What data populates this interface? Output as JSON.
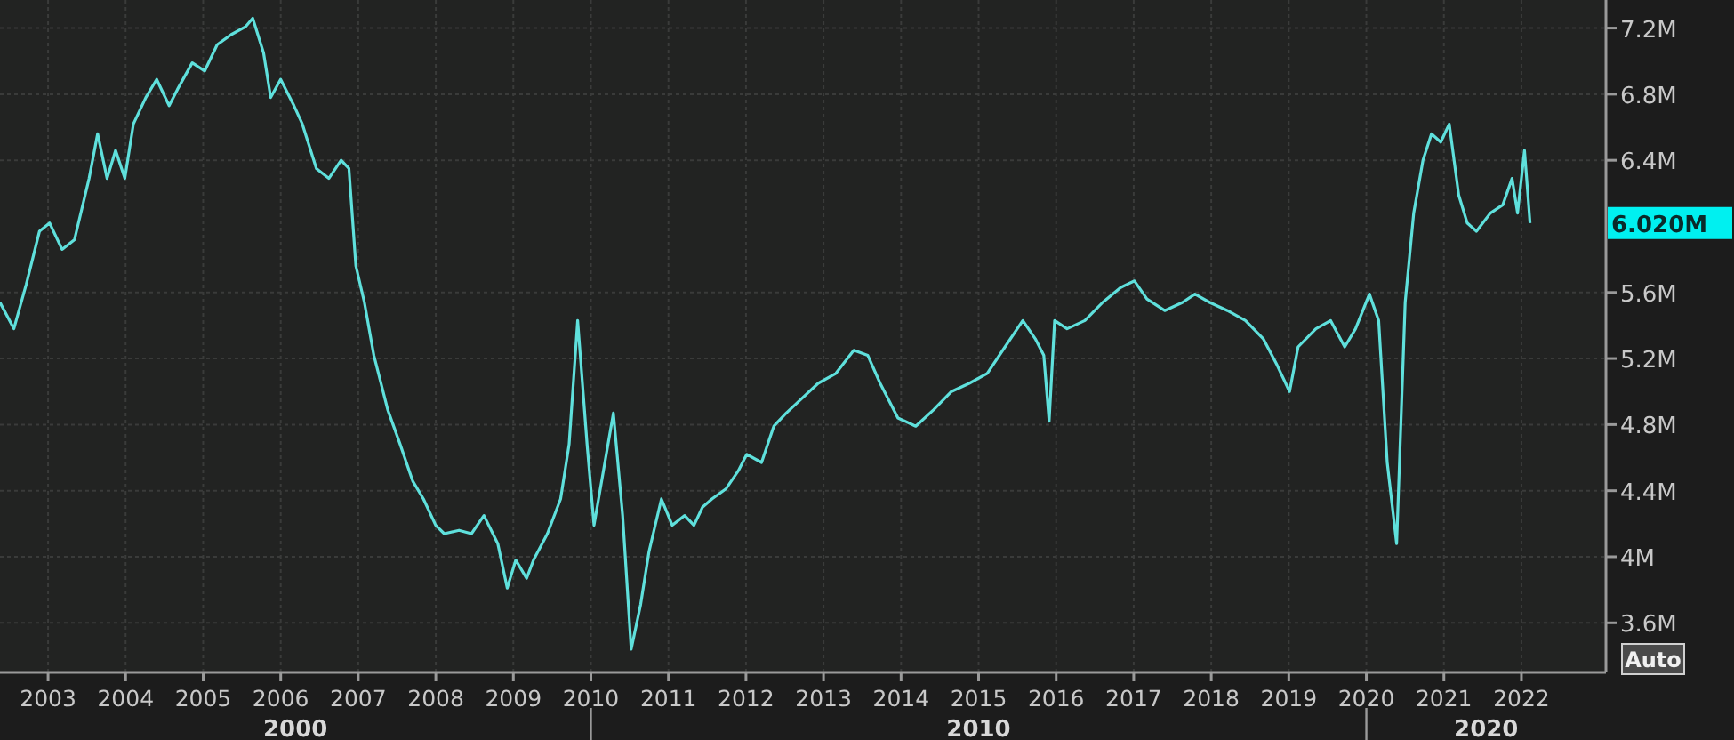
{
  "chart": {
    "chart_data": {
      "type": "line",
      "x": [
        2002.38,
        2002.56,
        2002.72,
        2002.89,
        2003.02,
        2003.18,
        2003.34,
        2003.53,
        2003.64,
        2003.76,
        2003.87,
        2003.99,
        2004.1,
        2004.26,
        2004.4,
        2004.56,
        2004.67,
        2004.86,
        2005.02,
        2005.18,
        2005.36,
        2005.55,
        2005.64,
        2005.78,
        2005.87,
        2006.0,
        2006.17,
        2006.28,
        2006.46,
        2006.62,
        2006.78,
        2006.88,
        2006.97,
        2007.08,
        2007.2,
        2007.38,
        2007.54,
        2007.7,
        2007.84,
        2008.0,
        2008.11,
        2008.3,
        2008.46,
        2008.62,
        2008.8,
        2008.92,
        2009.03,
        2009.17,
        2009.26,
        2009.44,
        2009.61,
        2009.72,
        2009.83,
        2009.95,
        2010.04,
        2010.18,
        2010.29,
        2010.41,
        2010.52,
        2010.64,
        2010.75,
        2010.91,
        2011.05,
        2011.21,
        2011.33,
        2011.44,
        2011.56,
        2011.74,
        2011.9,
        2012.01,
        2012.2,
        2012.36,
        2012.52,
        2012.7,
        2012.93,
        2013.16,
        2013.39,
        2013.57,
        2013.73,
        2013.96,
        2014.19,
        2014.42,
        2014.65,
        2014.88,
        2015.11,
        2015.34,
        2015.57,
        2015.73,
        2015.84,
        2015.91,
        2015.98,
        2016.14,
        2016.37,
        2016.6,
        2016.83,
        2017.01,
        2017.17,
        2017.4,
        2017.63,
        2017.79,
        2017.98,
        2018.21,
        2018.44,
        2018.67,
        2018.85,
        2019.01,
        2019.12,
        2019.35,
        2019.54,
        2019.72,
        2019.86,
        2020.04,
        2020.16,
        2020.27,
        2020.39,
        2020.5,
        2020.61,
        2020.73,
        2020.84,
        2020.96,
        2021.07,
        2021.19,
        2021.3,
        2021.42,
        2021.6,
        2021.76,
        2021.88,
        2021.95,
        2022.04,
        2022.11
      ],
      "series": [
        {
          "color": "#5fe0dc",
          "values": [
            5.54,
            5.38,
            5.65,
            5.97,
            6.02,
            5.86,
            5.92,
            6.29,
            6.56,
            6.29,
            6.46,
            6.29,
            6.62,
            6.78,
            6.89,
            6.73,
            6.83,
            6.99,
            6.94,
            7.1,
            7.16,
            7.21,
            7.26,
            7.05,
            6.78,
            6.89,
            6.73,
            6.62,
            6.35,
            6.29,
            6.4,
            6.35,
            5.76,
            5.54,
            5.22,
            4.89,
            4.68,
            4.46,
            4.35,
            4.19,
            4.14,
            4.16,
            4.14,
            4.25,
            4.08,
            3.81,
            3.98,
            3.87,
            3.98,
            4.14,
            4.35,
            4.68,
            5.43,
            4.68,
            4.19,
            4.57,
            4.87,
            4.25,
            3.44,
            3.71,
            4.03,
            4.35,
            4.19,
            4.25,
            4.19,
            4.3,
            4.35,
            4.41,
            4.52,
            4.62,
            4.57,
            4.79,
            4.87,
            4.95,
            5.05,
            5.11,
            5.25,
            5.22,
            5.05,
            4.84,
            4.79,
            4.89,
            5.0,
            5.05,
            5.11,
            5.27,
            5.43,
            5.32,
            5.22,
            4.82,
            5.43,
            5.38,
            5.43,
            5.54,
            5.63,
            5.67,
            5.56,
            5.49,
            5.54,
            5.59,
            5.54,
            5.49,
            5.43,
            5.32,
            5.16,
            5.0,
            5.27,
            5.38,
            5.43,
            5.27,
            5.38,
            5.59,
            5.43,
            4.57,
            4.08,
            5.54,
            6.08,
            6.4,
            6.56,
            6.51,
            6.62,
            6.19,
            6.02,
            5.97,
            6.08,
            6.13,
            6.29,
            6.08,
            6.46,
            6.02
          ]
        }
      ],
      "xlim": [
        2002.38,
        2023.09
      ],
      "ylim": [
        3.3,
        7.37
      ],
      "grid": true,
      "xticks": [
        {
          "value": 2003,
          "label": "2003"
        },
        {
          "value": 2004,
          "label": "2004"
        },
        {
          "value": 2005,
          "label": "2005"
        },
        {
          "value": 2006,
          "label": "2006"
        },
        {
          "value": 2007,
          "label": "2007"
        },
        {
          "value": 2008,
          "label": "2008"
        },
        {
          "value": 2009,
          "label": "2009"
        },
        {
          "value": 2010,
          "label": "2010"
        },
        {
          "value": 2011,
          "label": "2011"
        },
        {
          "value": 2012,
          "label": "2012"
        },
        {
          "value": 2013,
          "label": "2013"
        },
        {
          "value": 2014,
          "label": "2014"
        },
        {
          "value": 2015,
          "label": "2015"
        },
        {
          "value": 2016,
          "label": "2016"
        },
        {
          "value": 2017,
          "label": "2017"
        },
        {
          "value": 2018,
          "label": "2018"
        },
        {
          "value": 2019,
          "label": "2019"
        },
        {
          "value": 2020,
          "label": "2020"
        },
        {
          "value": 2021,
          "label": "2021"
        },
        {
          "value": 2022,
          "label": "2022"
        }
      ],
      "yticks": [
        {
          "value": 7.2,
          "label": "7.2M"
        },
        {
          "value": 6.8,
          "label": "6.8M"
        },
        {
          "value": 6.4,
          "label": "6.4M"
        },
        {
          "value": 5.6,
          "label": "5.6M"
        },
        {
          "value": 5.2,
          "label": "5.2M"
        },
        {
          "value": 4.8,
          "label": "4.8M"
        },
        {
          "value": 4.4,
          "label": "4.4M"
        },
        {
          "value": 4,
          "label": "4M"
        },
        {
          "value": 3.6,
          "label": "3.6M"
        }
      ]
    },
    "last_value": {
      "label": "6.020M"
    },
    "scale_button": "Auto",
    "decades": [
      {
        "label": "2000"
      },
      {
        "label": "2010"
      },
      {
        "label": "2020"
      }
    ]
  }
}
